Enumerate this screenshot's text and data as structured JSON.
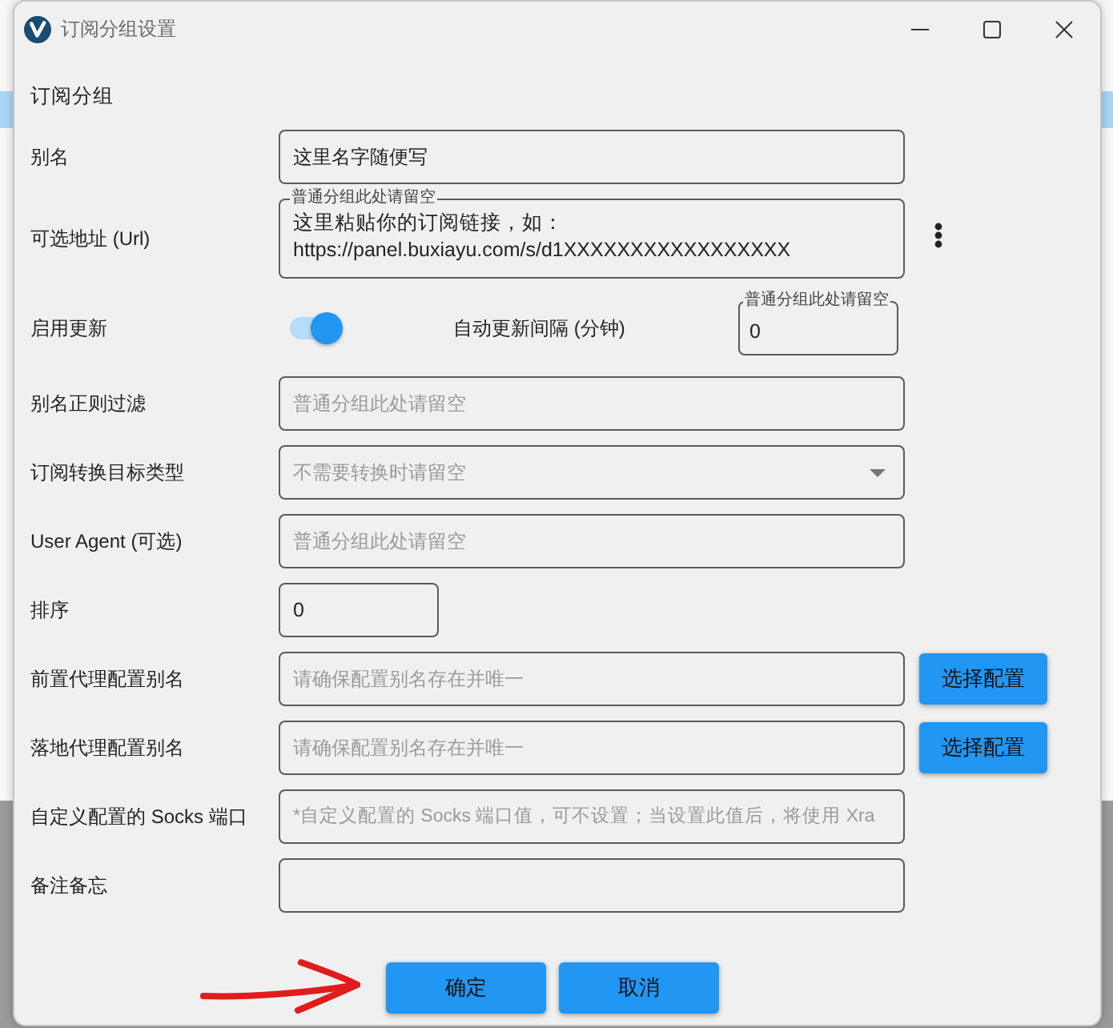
{
  "window": {
    "title": "订阅分组设置"
  },
  "section_title": "订阅分组",
  "fields": [
    {
      "kind": "text",
      "label": "别名",
      "value": "这里名字随便写"
    },
    {
      "kind": "multiline",
      "label": "可选地址 (Url)",
      "legend": "普通分组此处请留空",
      "value": "这里粘贴你的订阅链接，如：\nhttps://panel.buxiayu.com/s/d1XXXXXXXXXXXXXXXXX",
      "menu": true
    },
    {
      "kind": "switch",
      "label": "启用更新",
      "on": true,
      "side_label": "自动更新间隔 (分钟)",
      "side_field": {
        "legend": "普通分组此处请留空",
        "value": "0"
      }
    },
    {
      "kind": "text",
      "label": "别名正则过滤",
      "placeholder": "普通分组此处请留空"
    },
    {
      "kind": "select",
      "label": "订阅转换目标类型",
      "placeholder": "不需要转换时请留空"
    },
    {
      "kind": "text",
      "label": "User Agent (可选)",
      "placeholder": "普通分组此处请留空"
    },
    {
      "kind": "number",
      "label": "排序",
      "value": "0"
    },
    {
      "kind": "text",
      "label": "前置代理配置别名",
      "placeholder": "请确保配置别名存在并唯一",
      "button": "选择配置"
    },
    {
      "kind": "text",
      "label": "落地代理配置别名",
      "placeholder": "请确保配置别名存在并唯一",
      "button": "选择配置"
    },
    {
      "kind": "text",
      "label": "自定义配置的 Socks 端口",
      "placeholder": "*自定义配置的 Socks 端口值，可不设置；当设置此值后，将使用 Xra"
    },
    {
      "kind": "text",
      "label": "备注备忘"
    }
  ],
  "buttons": [
    "确定",
    "取消"
  ]
}
